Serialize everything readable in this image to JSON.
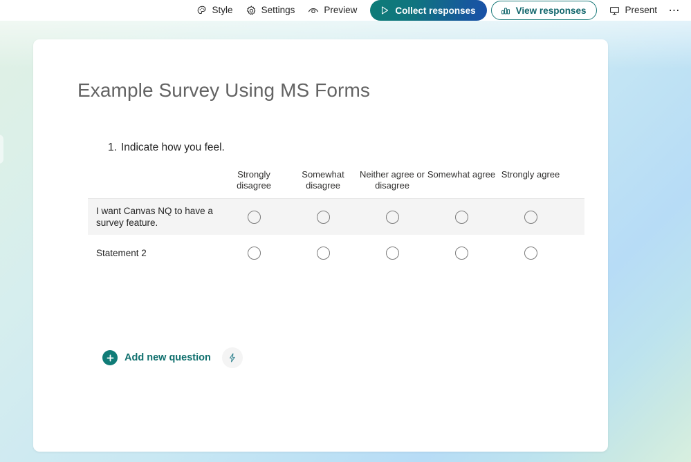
{
  "toolbar": {
    "items": [
      {
        "label": "Style",
        "icon": "palette-icon"
      },
      {
        "label": "Settings",
        "icon": "gear-icon"
      },
      {
        "label": "Preview",
        "icon": "eye-icon"
      }
    ],
    "collect_label": "Collect responses",
    "collect_icon": "send-triangle-icon",
    "view_label": "View responses",
    "view_icon": "bar-chart-icon",
    "present_label": "Present",
    "present_icon": "monitor-icon",
    "more_label": "⋯",
    "more_icon": "ellipsis-icon"
  },
  "form": {
    "title": "Example Survey Using MS Forms",
    "question": {
      "number": "1.",
      "text": "Indicate how you feel.",
      "columns": [
        "Strongly disagree",
        "Somewhat disagree",
        "Neither agree or disagree",
        "Somewhat agree",
        "Strongly agree"
      ],
      "rows": [
        {
          "statement": "I want Canvas NQ to have a survey feature."
        },
        {
          "statement": "Statement 2"
        }
      ]
    },
    "add_question_label": "Add new question",
    "add_question_icon": "plus-circle-icon",
    "ai_icon": "lightning-bolt-icon"
  },
  "colors": {
    "brand_teal": "#10706e",
    "collect_gradient_start": "#0e7c77",
    "collect_gradient_end": "#1a51a8",
    "title_gray": "#636363",
    "row_shade": "#f4f4f4",
    "canvas_green": "#dff0e4",
    "canvas_blue": "#b7dcf6"
  }
}
